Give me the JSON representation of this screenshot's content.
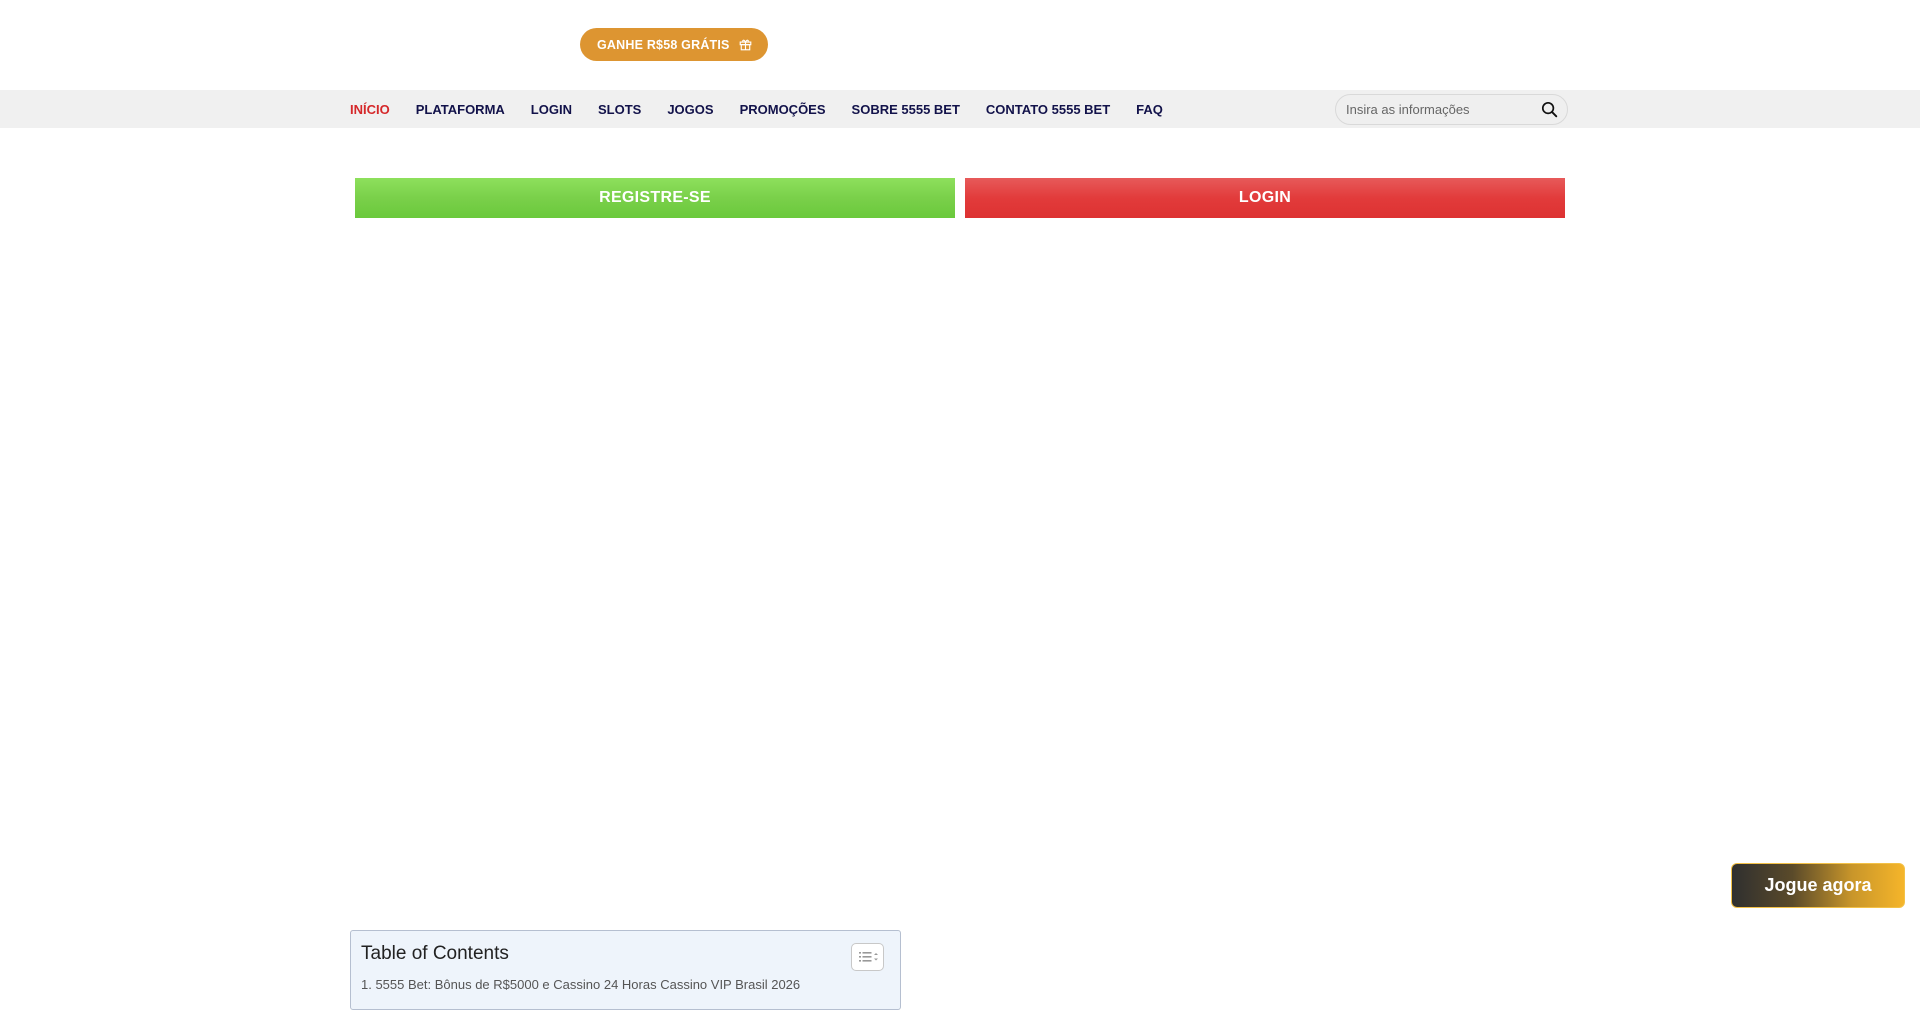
{
  "header": {
    "promo_label": "GANHE R$58 GRÁTIS"
  },
  "nav": {
    "items": [
      {
        "label": "INÍCIO",
        "active": true
      },
      {
        "label": "PLATAFORMA"
      },
      {
        "label": "LOGIN"
      },
      {
        "label": "SLOTS"
      },
      {
        "label": "JOGOS"
      },
      {
        "label": "PROMOÇÕES"
      },
      {
        "label": "SOBRE 5555 BET"
      },
      {
        "label": "CONTATO 5555 BET"
      },
      {
        "label": "FAQ"
      }
    ]
  },
  "search": {
    "placeholder": "Insira as informações",
    "icon": "search-icon"
  },
  "cta": {
    "register_label": "REGISTRE-SE",
    "login_label": "LOGIN"
  },
  "toc": {
    "title": "Table of Contents",
    "first_item": "1. 5555 Bet: Bônus de R$5000 e Cassino 24 Horas Cassino VIP Brasil 2026"
  },
  "floating": {
    "play_label": "Jogue agora"
  },
  "colors": {
    "promo": "#dd9531",
    "nav_active": "#d5282a",
    "nav_text": "#12124a",
    "register": "#7ad04a",
    "login": "#e23b3b"
  }
}
